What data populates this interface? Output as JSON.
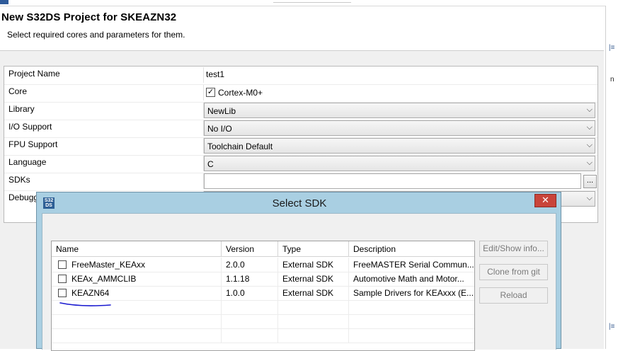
{
  "window": {
    "title": "New S32DS Project for SKEAZN32",
    "subtitle": "Select required cores and parameters for them."
  },
  "right_panel": {
    "glyph_a": "|≡",
    "glyph_b": "n",
    "glyph_c": "|≡"
  },
  "form": {
    "rows": [
      {
        "label": "Project Name",
        "value": "test1"
      },
      {
        "label": "Core",
        "value": "Cortex-M0+",
        "checked": true
      },
      {
        "label": "Library",
        "value": "NewLib"
      },
      {
        "label": "I/O Support",
        "value": "No I/O"
      },
      {
        "label": "FPU Support",
        "value": "Toolchain Default"
      },
      {
        "label": "Language",
        "value": "C"
      },
      {
        "label": "SDKs",
        "value": "",
        "button": "..."
      },
      {
        "label": "Debugg",
        "value": ""
      }
    ]
  },
  "dialog": {
    "title": "Select SDK",
    "icon_text": "S32 DS",
    "close": "✕",
    "columns": [
      "Name",
      "Version",
      "Type",
      "Description"
    ],
    "rows": [
      {
        "name": "FreeMaster_KEAxx",
        "version": "2.0.0",
        "type": "External SDK",
        "description": "FreeMASTER Serial Commun...",
        "checked": false
      },
      {
        "name": "KEAx_AMMCLIB",
        "version": "1.1.18",
        "type": "External SDK",
        "description": "Automotive Math and Motor...",
        "checked": false
      },
      {
        "name": "KEAZN64",
        "version": "1.0.0",
        "type": "External SDK",
        "description": "Sample Drivers for KEAxxx (E...",
        "checked": false
      }
    ],
    "buttons": {
      "edit_show_info": "Edit/Show info...",
      "clone_from_git": "Clone from git",
      "reload": "Reload"
    }
  },
  "colors": {
    "accent": "#a9cfe2",
    "close": "#c9443a",
    "annotation": "#1a1ad0"
  }
}
